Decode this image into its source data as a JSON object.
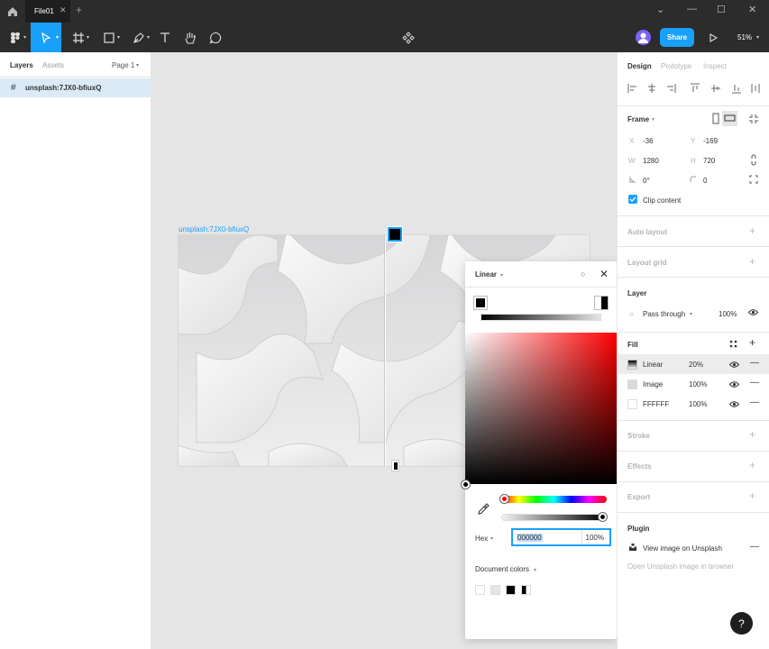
{
  "titlebar": {
    "tab_label": "File01",
    "tab_close": "✕",
    "new_tab": "+",
    "minimize": "⌄",
    "min2": "—",
    "maximize": "☐",
    "close": "✕"
  },
  "toolbar": {
    "share_label": "Share",
    "zoom": "51%"
  },
  "left": {
    "tab_layers": "Layers",
    "tab_assets": "Assets",
    "page": "Page 1",
    "layer_name": "unsplash:7JX0-bfiuxQ"
  },
  "canvas": {
    "frame_label": "unsplash:7JX0-bfiuxQ"
  },
  "picker": {
    "type": "Linear",
    "hex_label": "Hex",
    "hex_value": "000000",
    "opacity": "100%",
    "doc_colors": "Document colors"
  },
  "right": {
    "tabs": [
      "Design",
      "Prototype",
      "Inspect"
    ],
    "frame": {
      "title": "Frame",
      "x_label": "X",
      "x": "-36",
      "y_label": "Y",
      "y": "-169",
      "w_label": "W",
      "w": "1280",
      "h_label": "H",
      "h": "720",
      "rot": "0°",
      "radius": "0",
      "clip": "Clip content"
    },
    "auto_layout": "Auto layout",
    "layout_grid": "Layout grid",
    "layer": {
      "title": "Layer",
      "blend": "Pass through",
      "opacity": "100%"
    },
    "fill": {
      "title": "Fill",
      "items": [
        {
          "name": "Linear",
          "opacity": "20%"
        },
        {
          "name": "Image",
          "opacity": "100%"
        },
        {
          "name": "FFFFFF",
          "opacity": "100%"
        }
      ]
    },
    "stroke": "Stroke",
    "effects": "Effects",
    "export": "Export",
    "plugin": {
      "title": "Plugin",
      "item": "View image on Unsplash",
      "link": "Open Unsplash image in browser"
    }
  },
  "help": "?",
  "colors": {
    "accent": "#18a0fb",
    "toolbar": "#2c2c2c",
    "selection": "#daebf7"
  }
}
